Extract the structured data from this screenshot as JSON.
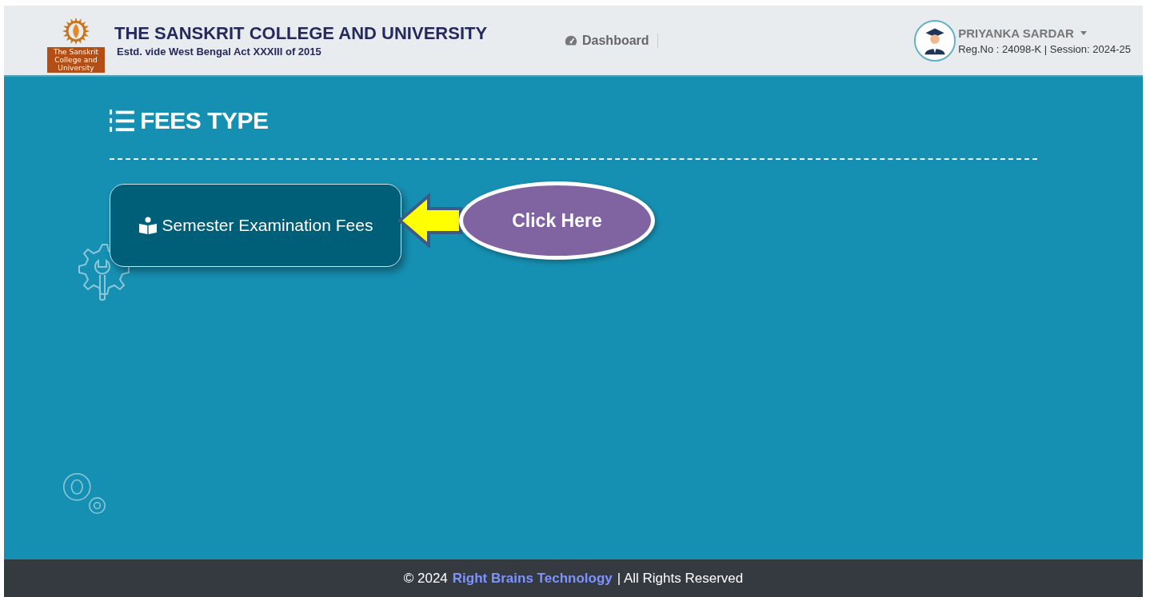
{
  "header": {
    "logo_caption": "The Sanskrit College and University",
    "title": "THE SANSKRIT COLLEGE AND UNIVERSITY",
    "subtitle": "Estd. vide West Bengal Act XXXIII of 2015",
    "nav": [
      {
        "label": "Dashboard"
      }
    ],
    "user": {
      "name": "PRIYANKA SARDAR",
      "details": "Reg.No : 24098-K | Session: 2024-25"
    }
  },
  "page": {
    "heading": "FEES TYPE",
    "fee_types": [
      {
        "label": "Semester Examination Fees"
      }
    ],
    "callout": {
      "label": "Click Here"
    }
  },
  "footer": {
    "prefix": "© 2024",
    "link": "Right Brains Technology",
    "suffix": "| All Rights Reserved"
  }
}
